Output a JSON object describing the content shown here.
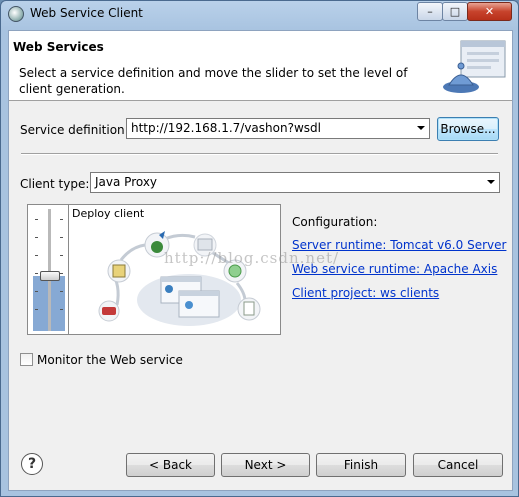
{
  "window": {
    "title": "Web Service Client",
    "controls": {
      "minimize": "–",
      "maximize": "□",
      "close": "✕"
    }
  },
  "banner": {
    "title": "Web Services",
    "description": "Select a service definition and move the slider to set the level of client generation."
  },
  "service_definition": {
    "label": "Service definition:",
    "value": "http://192.168.1.7/vashon?wsdl",
    "browse_label": "Browse..."
  },
  "client_type": {
    "label": "Client type:",
    "value": "Java Proxy"
  },
  "slider": {
    "level_label": "Deploy client",
    "level_fraction": 0.45
  },
  "configuration": {
    "title": "Configuration:",
    "server_runtime": "Server runtime: Tomcat v6.0 Server",
    "ws_runtime": "Web service runtime: Apache Axis",
    "client_project": "Client project: ws clients"
  },
  "monitor": {
    "label": "Monitor the Web service",
    "checked": false
  },
  "footer": {
    "help": "?",
    "back": "< Back",
    "next": "Next >",
    "finish": "Finish",
    "cancel": "Cancel"
  },
  "watermark": "http://blog.csdn.net/"
}
